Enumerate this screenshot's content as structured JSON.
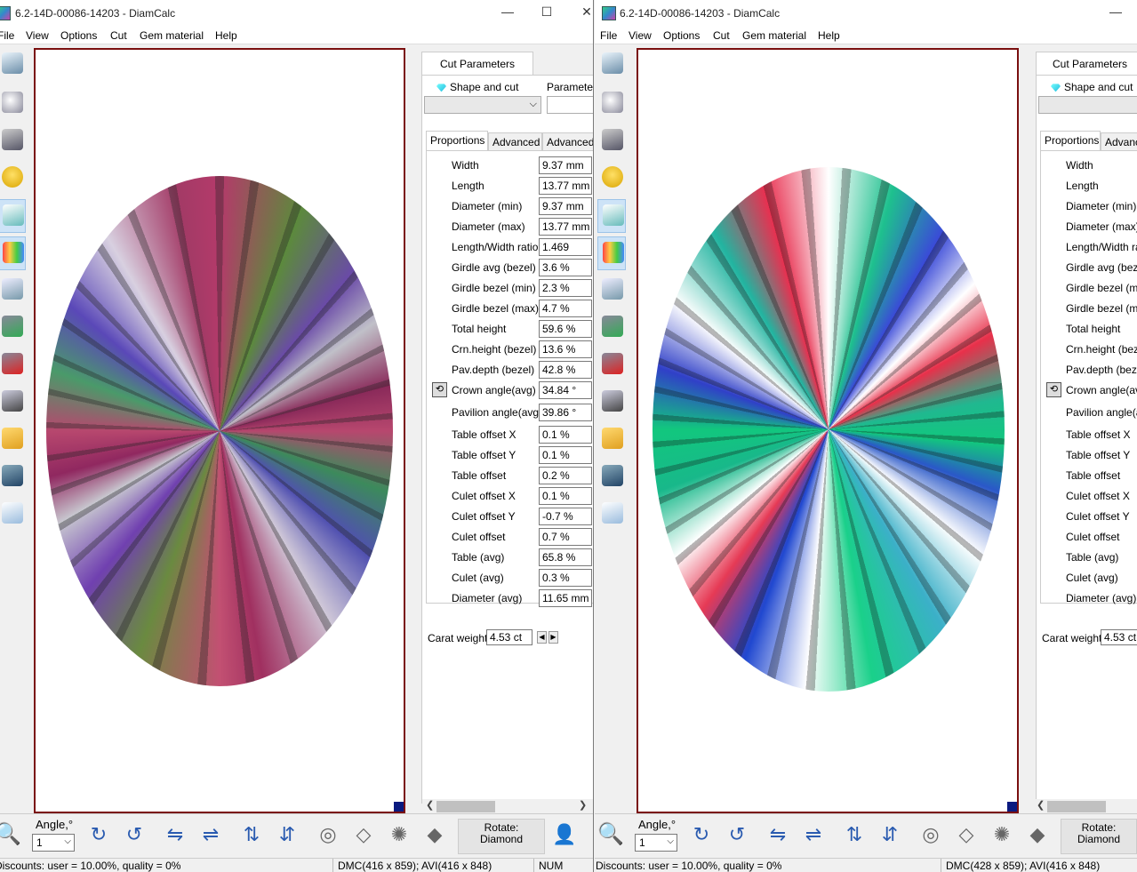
{
  "windows": [
    {
      "title": "6.2-14D-00086-14203 - DiamCalc",
      "menu": [
        "File",
        "View",
        "Options",
        "Cut",
        "Gem material",
        "Help"
      ],
      "panel_tab": "Cut Parameters",
      "shape_label": "Shape and cut",
      "parameters_label": "Parameters",
      "subtabs": [
        "Proportions",
        "Advanced",
        "Advanced"
      ],
      "params": [
        {
          "label": "Width",
          "value": "9.37 mm"
        },
        {
          "label": "Length",
          "value": "13.77 mm"
        },
        {
          "label": "Diameter (min)",
          "value": "9.37 mm"
        },
        {
          "label": "Diameter (max)",
          "value": "13.77 mm"
        },
        {
          "label": "Length/Width ratio",
          "value": "1.469"
        },
        {
          "label": "Girdle avg (bezel)",
          "value": "3.6 %"
        },
        {
          "label": "Girdle bezel (min)",
          "value": "2.3 %"
        },
        {
          "label": "Girdle bezel (max)",
          "value": "4.7 %"
        },
        {
          "label": "Total height",
          "value": "59.6 %"
        },
        {
          "label": "Crn.height (bezel)",
          "value": "13.6 %"
        },
        {
          "label": "Pav.depth (bezel)",
          "value": "42.8 %"
        },
        {
          "label": "Crown angle(avg)",
          "value": "34.84 °"
        },
        {
          "label": "Pavilion angle(avg)",
          "value": "39.86 °"
        },
        {
          "label": "Table offset X",
          "value": "0.1 %"
        },
        {
          "label": "Table offset Y",
          "value": "0.1 %"
        },
        {
          "label": "Table offset",
          "value": "0.2 %"
        },
        {
          "label": "Culet offset X",
          "value": "0.1 %"
        },
        {
          "label": "Culet offset Y",
          "value": "-0.7 %"
        },
        {
          "label": "Culet offset",
          "value": "0.7 %"
        },
        {
          "label": "Table (avg)",
          "value": "65.8 %"
        },
        {
          "label": "Culet (avg)",
          "value": "0.3 %"
        },
        {
          "label": "Diameter (avg)",
          "value": "11.65 mm"
        }
      ],
      "carat_label": "Carat weight",
      "carat_value": "4.53 ct",
      "angle_label": "Angle,°",
      "angle_value": "1",
      "rotate_label": "Rotate:",
      "rotate_value": "Diamond",
      "status_discounts": "Discounts: user = 10.00%, quality = 0%",
      "status_dmc": "DMC(416 x 859); AVI(416 x 848)",
      "status_num": "NUM"
    },
    {
      "title": "6.2-14D-00086-14203 - DiamCalc",
      "menu": [
        "File",
        "View",
        "Options",
        "Cut",
        "Gem material",
        "Help"
      ],
      "panel_tab": "Cut Parameters",
      "shape_label": "Shape and cut",
      "subtabs": [
        "Proportions",
        "Advanced"
      ],
      "params": [
        {
          "label": "Width"
        },
        {
          "label": "Length"
        },
        {
          "label": "Diameter (min)"
        },
        {
          "label": "Diameter (max)"
        },
        {
          "label": "Length/Width ratio"
        },
        {
          "label": "Girdle avg (bezel)"
        },
        {
          "label": "Girdle bezel (min)"
        },
        {
          "label": "Girdle bezel (max)"
        },
        {
          "label": "Total height"
        },
        {
          "label": "Crn.height (bezel)"
        },
        {
          "label": "Pav.depth (bezel)"
        },
        {
          "label": "Crown angle(avg)"
        },
        {
          "label": "Pavilion angle(avg)"
        },
        {
          "label": "Table offset X"
        },
        {
          "label": "Table offset Y"
        },
        {
          "label": "Table offset"
        },
        {
          "label": "Culet offset X"
        },
        {
          "label": "Culet offset Y"
        },
        {
          "label": "Culet offset"
        },
        {
          "label": "Table (avg)"
        },
        {
          "label": "Culet (avg)"
        },
        {
          "label": "Diameter (avg)"
        }
      ],
      "carat_label": "Carat weight",
      "carat_value": "4.53 ct",
      "angle_label": "Angle,°",
      "angle_value": "1",
      "rotate_label": "Rotate:",
      "rotate_value": "Diamond",
      "status_discounts": "Discounts: user = 10.00%, quality = 0%",
      "status_dmc": "DMC(428 x 859); AVI(416 x 848)"
    }
  ],
  "window_controls": {
    "minimize": "—",
    "maximize": "☐",
    "close": "✕"
  },
  "colors": {
    "canvas_border": "#7a1010",
    "nav_block": "#0a1a80",
    "gem_left_base": "#9a3d6a",
    "gem_right_base": "#19b98a"
  }
}
